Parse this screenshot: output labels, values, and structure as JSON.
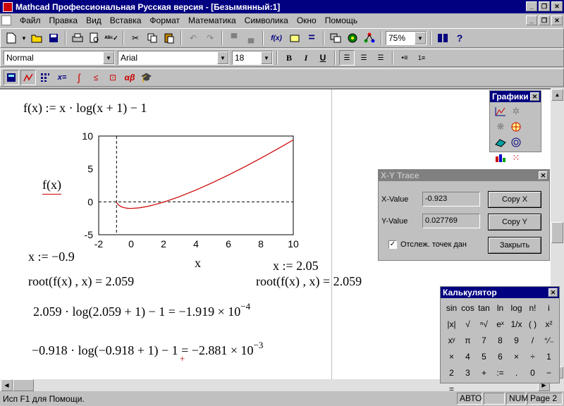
{
  "window": {
    "title": "Mathcad Профессиональная Русская версия - [Безымянный:1]",
    "minimize": "_",
    "restore": "❐",
    "close": "✕"
  },
  "menu": [
    "Файл",
    "Правка",
    "Вид",
    "Вставка",
    "Формат",
    "Математика",
    "Символика",
    "Окно",
    "Помощь"
  ],
  "toolbar": {
    "zoom": "75%",
    "style": "Normal",
    "font": "Arial",
    "size": "18",
    "bold": "B",
    "italic": "I",
    "underline": "U",
    "math_x_eq": "x=",
    "math_ab": "αβ",
    "fx": "f(x)"
  },
  "worksheet": {
    "definition": "f(x) := x · log(x + 1) − 1",
    "plot_ylabel": "f(x)",
    "plot_xlabel": "x",
    "assign1": "x := −0.9",
    "assign2": "x := 2.05",
    "root1": "root(f(x) , x) = 2.059",
    "root2": "root(f(x) , x) = 2.059",
    "check1_main": "2.059 · log(2.059 + 1) − 1 = −1.919 × 10",
    "check1_exp": "−4",
    "check2_main": "−0.918 · log(−0.918 + 1) − 1 = −2.881 × 10",
    "check2_exp": "−3",
    "cursor_mark": "+"
  },
  "chart_data": {
    "type": "line",
    "xlim": [
      -2,
      10
    ],
    "ylim": [
      -5,
      10
    ],
    "xticks": [
      "-2",
      "0",
      "2",
      "4",
      "6",
      "8",
      "10"
    ],
    "yticks": [
      "10",
      "5",
      "0",
      "-5"
    ],
    "xlabel": "x",
    "ylabel": "f(x)",
    "x": [
      -0.9,
      -0.8,
      -0.6,
      -0.4,
      -0.2,
      0,
      0.5,
      1,
      1.5,
      2,
      3,
      4,
      5,
      6,
      7,
      8,
      9,
      10
    ],
    "y": [
      -0.09,
      -0.441,
      -0.761,
      -0.911,
      -0.981,
      -1,
      -0.912,
      -0.699,
      -0.403,
      -0.046,
      0.806,
      1.796,
      2.891,
      4.07,
      5.322,
      6.633,
      8.0,
      9.414
    ],
    "series_color": "#cc0000",
    "dashed_lines": {
      "vertical_x": -0.9,
      "horizontal_y": 0
    },
    "grid": false
  },
  "graphs_palette": {
    "title": "Графики",
    "close": "✕"
  },
  "trace": {
    "title": "X-Y Trace",
    "close": "✕",
    "x_label": "X-Value",
    "x_value": "-0.923",
    "y_label": "Y-Value",
    "y_value": "0.027769",
    "copy_x": "Copy X",
    "copy_y": "Copy Y",
    "track_label": "Отслеж. точек дан",
    "track_checked": "✓",
    "close_btn": "Закрыть"
  },
  "calculator": {
    "title": "Калькулятор",
    "close": "✕",
    "keys": [
      "sin",
      "cos",
      "tan",
      "ln",
      "log",
      "n!",
      "i",
      "|x|",
      "√",
      "ⁿ√",
      "eˣ",
      "1/x",
      "( )",
      "x²",
      "xʸ",
      "π",
      "7",
      "8",
      "9",
      "/",
      "⁺⁄₋",
      "×",
      "4",
      "5",
      "6",
      "×",
      "÷",
      "1",
      "2",
      "3",
      "+",
      ":=",
      ".",
      "0",
      "−",
      "="
    ]
  },
  "status": {
    "help": "Исп F1 для Помощи.",
    "mode": "АВТО",
    "num": "NUM",
    "page": "Page 2"
  },
  "colors": {
    "titlebar": "#000080",
    "face": "#c0c0c0",
    "curve": "#cc0000"
  }
}
